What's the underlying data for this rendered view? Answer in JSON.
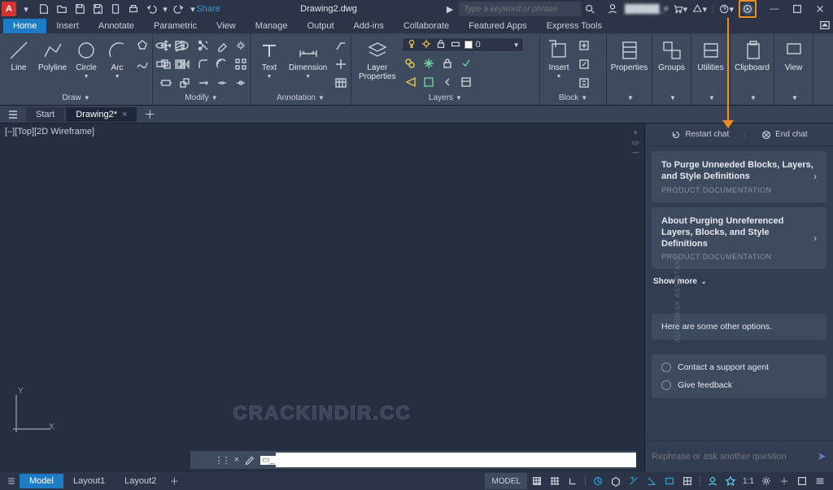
{
  "app": {
    "badge": "A",
    "filename": "Drawing2.dwg"
  },
  "qat": {
    "share": "Share"
  },
  "search": {
    "placeholder": "Type a keyword or phrase"
  },
  "title_right": {
    "user_blur": "██████_▾",
    "signin_sep": "·"
  },
  "ribbon_tabs": [
    "Home",
    "Insert",
    "Annotate",
    "Parametric",
    "View",
    "Manage",
    "Output",
    "Add-ins",
    "Collaborate",
    "Featured Apps",
    "Express Tools"
  ],
  "draw": {
    "label": "Draw",
    "tools": [
      {
        "name": "line",
        "label": "Line"
      },
      {
        "name": "polyline",
        "label": "Polyline"
      },
      {
        "name": "circle",
        "label": "Circle"
      },
      {
        "name": "arc",
        "label": "Arc"
      }
    ]
  },
  "modify": {
    "label": "Modify"
  },
  "annotation": {
    "label": "Annotation",
    "text": "Text",
    "dimension": "Dimension"
  },
  "layers": {
    "label": "Layers",
    "properties": "Layer\nProperties",
    "current": "0"
  },
  "block": {
    "label": "Block",
    "insert": "Insert"
  },
  "panels": {
    "properties": "Properties",
    "groups": "Groups",
    "utilities": "Utilities",
    "clipboard": "Clipboard",
    "view": "View"
  },
  "doc_tabs": {
    "start": "Start",
    "active": "Drawing2*"
  },
  "view_label": "[–][Top][2D Wireframe]",
  "watermark": "CRACKINDIR.CC",
  "ucs": {
    "x": "X",
    "y": "Y"
  },
  "assistant": {
    "vlabel": "AUTODESK ASSISTANT",
    "restart": "Restart chat",
    "end": "End chat",
    "cards": [
      {
        "title": "To Purge Unneeded Blocks, Layers, and Style Definitions",
        "sub": "PRODUCT DOCUMENTATION"
      },
      {
        "title": "About Purging Unreferenced Layers, Blocks, and Style Definitions",
        "sub": "PRODUCT DOCUMENTATION"
      }
    ],
    "showmore": "Show more",
    "bubble": "Here are some other options.",
    "options": [
      "Contact a support agent",
      "Give feedback"
    ],
    "placeholder": "Rephrase or ask another question"
  },
  "status": {
    "model_tab": "Model",
    "layout1": "Layout1",
    "layout2": "Layout2",
    "mode_btn": "MODEL",
    "scale": "1:1"
  }
}
